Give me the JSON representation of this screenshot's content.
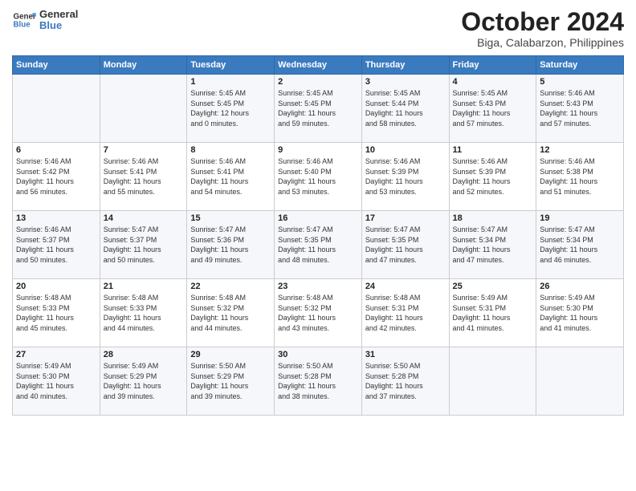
{
  "header": {
    "logo_line1": "General",
    "logo_line2": "Blue",
    "month": "October 2024",
    "location": "Biga, Calabarzon, Philippines"
  },
  "weekdays": [
    "Sunday",
    "Monday",
    "Tuesday",
    "Wednesday",
    "Thursday",
    "Friday",
    "Saturday"
  ],
  "weeks": [
    [
      {
        "day": "",
        "info": ""
      },
      {
        "day": "",
        "info": ""
      },
      {
        "day": "1",
        "info": "Sunrise: 5:45 AM\nSunset: 5:45 PM\nDaylight: 12 hours\nand 0 minutes."
      },
      {
        "day": "2",
        "info": "Sunrise: 5:45 AM\nSunset: 5:45 PM\nDaylight: 11 hours\nand 59 minutes."
      },
      {
        "day": "3",
        "info": "Sunrise: 5:45 AM\nSunset: 5:44 PM\nDaylight: 11 hours\nand 58 minutes."
      },
      {
        "day": "4",
        "info": "Sunrise: 5:45 AM\nSunset: 5:43 PM\nDaylight: 11 hours\nand 57 minutes."
      },
      {
        "day": "5",
        "info": "Sunrise: 5:46 AM\nSunset: 5:43 PM\nDaylight: 11 hours\nand 57 minutes."
      }
    ],
    [
      {
        "day": "6",
        "info": "Sunrise: 5:46 AM\nSunset: 5:42 PM\nDaylight: 11 hours\nand 56 minutes."
      },
      {
        "day": "7",
        "info": "Sunrise: 5:46 AM\nSunset: 5:41 PM\nDaylight: 11 hours\nand 55 minutes."
      },
      {
        "day": "8",
        "info": "Sunrise: 5:46 AM\nSunset: 5:41 PM\nDaylight: 11 hours\nand 54 minutes."
      },
      {
        "day": "9",
        "info": "Sunrise: 5:46 AM\nSunset: 5:40 PM\nDaylight: 11 hours\nand 53 minutes."
      },
      {
        "day": "10",
        "info": "Sunrise: 5:46 AM\nSunset: 5:39 PM\nDaylight: 11 hours\nand 53 minutes."
      },
      {
        "day": "11",
        "info": "Sunrise: 5:46 AM\nSunset: 5:39 PM\nDaylight: 11 hours\nand 52 minutes."
      },
      {
        "day": "12",
        "info": "Sunrise: 5:46 AM\nSunset: 5:38 PM\nDaylight: 11 hours\nand 51 minutes."
      }
    ],
    [
      {
        "day": "13",
        "info": "Sunrise: 5:46 AM\nSunset: 5:37 PM\nDaylight: 11 hours\nand 50 minutes."
      },
      {
        "day": "14",
        "info": "Sunrise: 5:47 AM\nSunset: 5:37 PM\nDaylight: 11 hours\nand 50 minutes."
      },
      {
        "day": "15",
        "info": "Sunrise: 5:47 AM\nSunset: 5:36 PM\nDaylight: 11 hours\nand 49 minutes."
      },
      {
        "day": "16",
        "info": "Sunrise: 5:47 AM\nSunset: 5:35 PM\nDaylight: 11 hours\nand 48 minutes."
      },
      {
        "day": "17",
        "info": "Sunrise: 5:47 AM\nSunset: 5:35 PM\nDaylight: 11 hours\nand 47 minutes."
      },
      {
        "day": "18",
        "info": "Sunrise: 5:47 AM\nSunset: 5:34 PM\nDaylight: 11 hours\nand 47 minutes."
      },
      {
        "day": "19",
        "info": "Sunrise: 5:47 AM\nSunset: 5:34 PM\nDaylight: 11 hours\nand 46 minutes."
      }
    ],
    [
      {
        "day": "20",
        "info": "Sunrise: 5:48 AM\nSunset: 5:33 PM\nDaylight: 11 hours\nand 45 minutes."
      },
      {
        "day": "21",
        "info": "Sunrise: 5:48 AM\nSunset: 5:33 PM\nDaylight: 11 hours\nand 44 minutes."
      },
      {
        "day": "22",
        "info": "Sunrise: 5:48 AM\nSunset: 5:32 PM\nDaylight: 11 hours\nand 44 minutes."
      },
      {
        "day": "23",
        "info": "Sunrise: 5:48 AM\nSunset: 5:32 PM\nDaylight: 11 hours\nand 43 minutes."
      },
      {
        "day": "24",
        "info": "Sunrise: 5:48 AM\nSunset: 5:31 PM\nDaylight: 11 hours\nand 42 minutes."
      },
      {
        "day": "25",
        "info": "Sunrise: 5:49 AM\nSunset: 5:31 PM\nDaylight: 11 hours\nand 41 minutes."
      },
      {
        "day": "26",
        "info": "Sunrise: 5:49 AM\nSunset: 5:30 PM\nDaylight: 11 hours\nand 41 minutes."
      }
    ],
    [
      {
        "day": "27",
        "info": "Sunrise: 5:49 AM\nSunset: 5:30 PM\nDaylight: 11 hours\nand 40 minutes."
      },
      {
        "day": "28",
        "info": "Sunrise: 5:49 AM\nSunset: 5:29 PM\nDaylight: 11 hours\nand 39 minutes."
      },
      {
        "day": "29",
        "info": "Sunrise: 5:50 AM\nSunset: 5:29 PM\nDaylight: 11 hours\nand 39 minutes."
      },
      {
        "day": "30",
        "info": "Sunrise: 5:50 AM\nSunset: 5:28 PM\nDaylight: 11 hours\nand 38 minutes."
      },
      {
        "day": "31",
        "info": "Sunrise: 5:50 AM\nSunset: 5:28 PM\nDaylight: 11 hours\nand 37 minutes."
      },
      {
        "day": "",
        "info": ""
      },
      {
        "day": "",
        "info": ""
      }
    ]
  ]
}
